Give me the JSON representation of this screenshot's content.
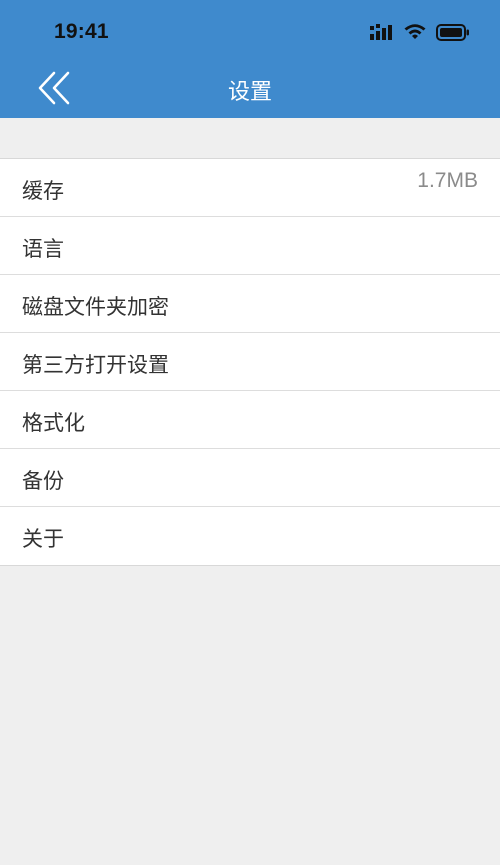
{
  "status_bar": {
    "time": "19:41"
  },
  "header": {
    "title": "设置",
    "back_icon": "double-chevron-left-icon",
    "background_color": "#3f8acd"
  },
  "settings": {
    "items": [
      {
        "label": "缓存",
        "value": "1.7MB"
      },
      {
        "label": "语言"
      },
      {
        "label": "磁盘文件夹加密"
      },
      {
        "label": "第三方打开设置"
      },
      {
        "label": "格式化"
      },
      {
        "label": "备份"
      },
      {
        "label": "关于"
      }
    ]
  }
}
